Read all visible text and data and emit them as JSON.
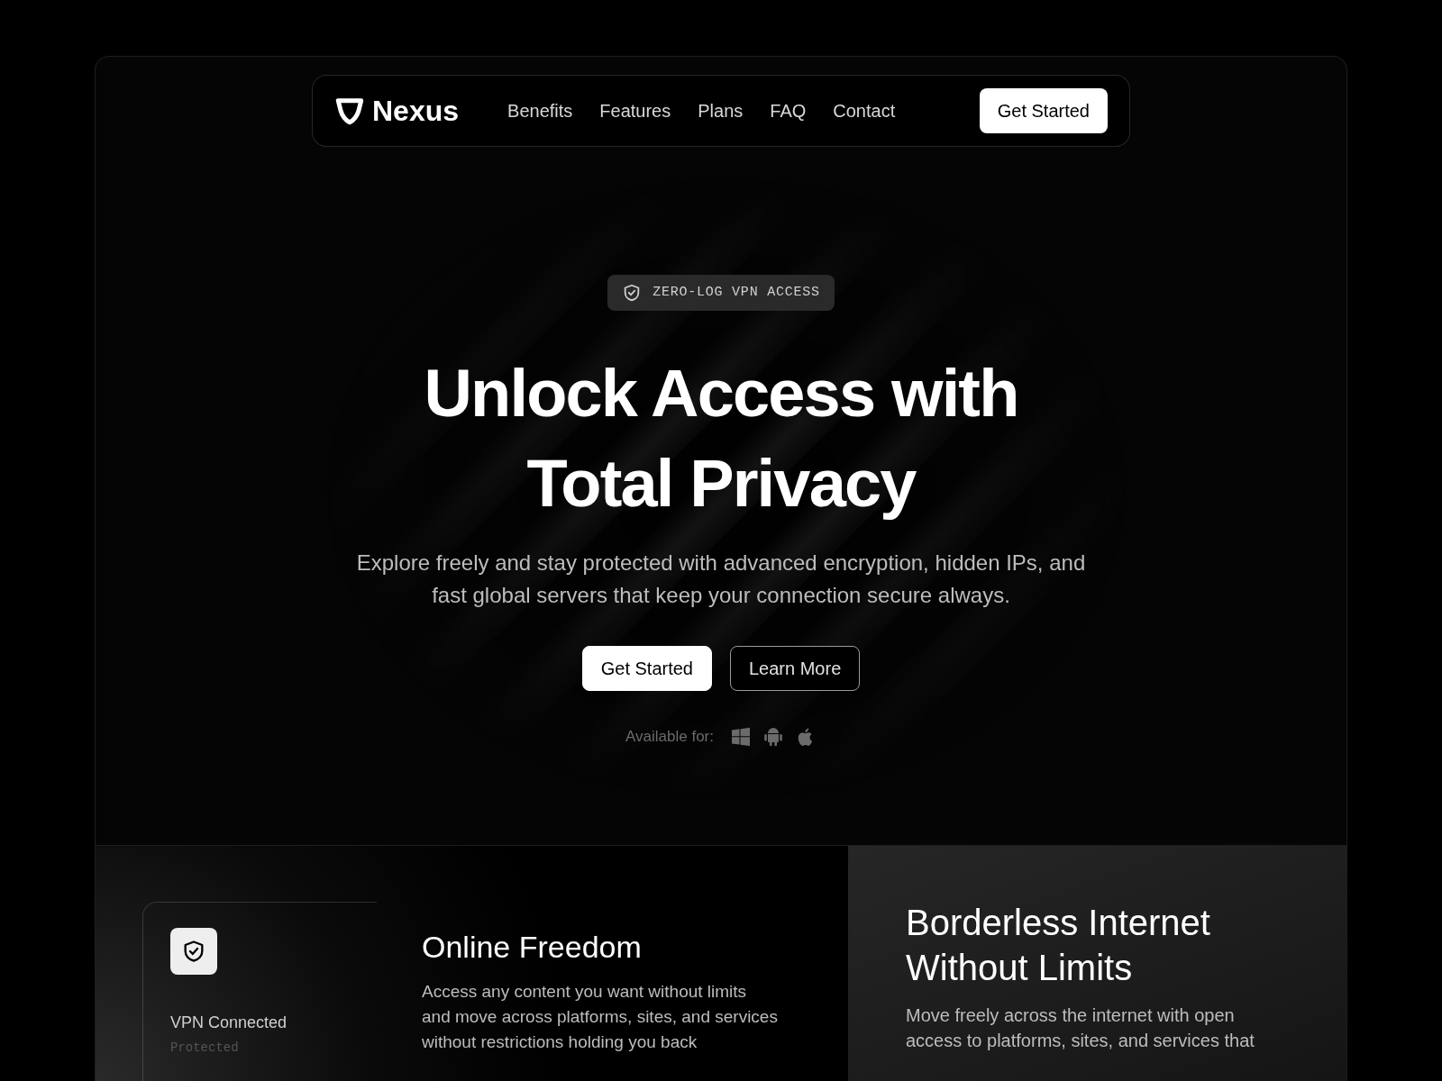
{
  "nav": {
    "brand": "Nexus",
    "links": [
      "Benefits",
      "Features",
      "Plans",
      "FAQ",
      "Contact"
    ],
    "cta": "Get Started"
  },
  "hero": {
    "badge": "ZERO-LOG VPN ACCESS",
    "title_lines": [
      "Unlock Access with",
      "Total Privacy"
    ],
    "subtitle_lines": [
      "Explore freely and stay protected with advanced encryption, hidden IPs, and",
      "fast global servers that keep your connection secure always."
    ],
    "buttons": [
      {
        "label": "Get Started",
        "kind": "primary"
      },
      {
        "label": "Learn More",
        "kind": "outline"
      }
    ],
    "available_label": "Available for:",
    "platforms": [
      {
        "kind": "windows"
      },
      {
        "kind": "android"
      },
      {
        "kind": "apple"
      }
    ]
  },
  "status_card": {
    "title": "VPN Connected",
    "subtitle": "Protected"
  },
  "feature": {
    "title": "Online Freedom",
    "lines": [
      "Access any content you want without limits",
      "and move across platforms, sites, and services",
      "without restrictions holding you back"
    ]
  },
  "side_panel": {
    "title_lines": [
      "Borderless Internet",
      "Without Limits"
    ],
    "lines": [
      "Move freely across the internet with open",
      "access to platforms, sites, and services that"
    ]
  }
}
